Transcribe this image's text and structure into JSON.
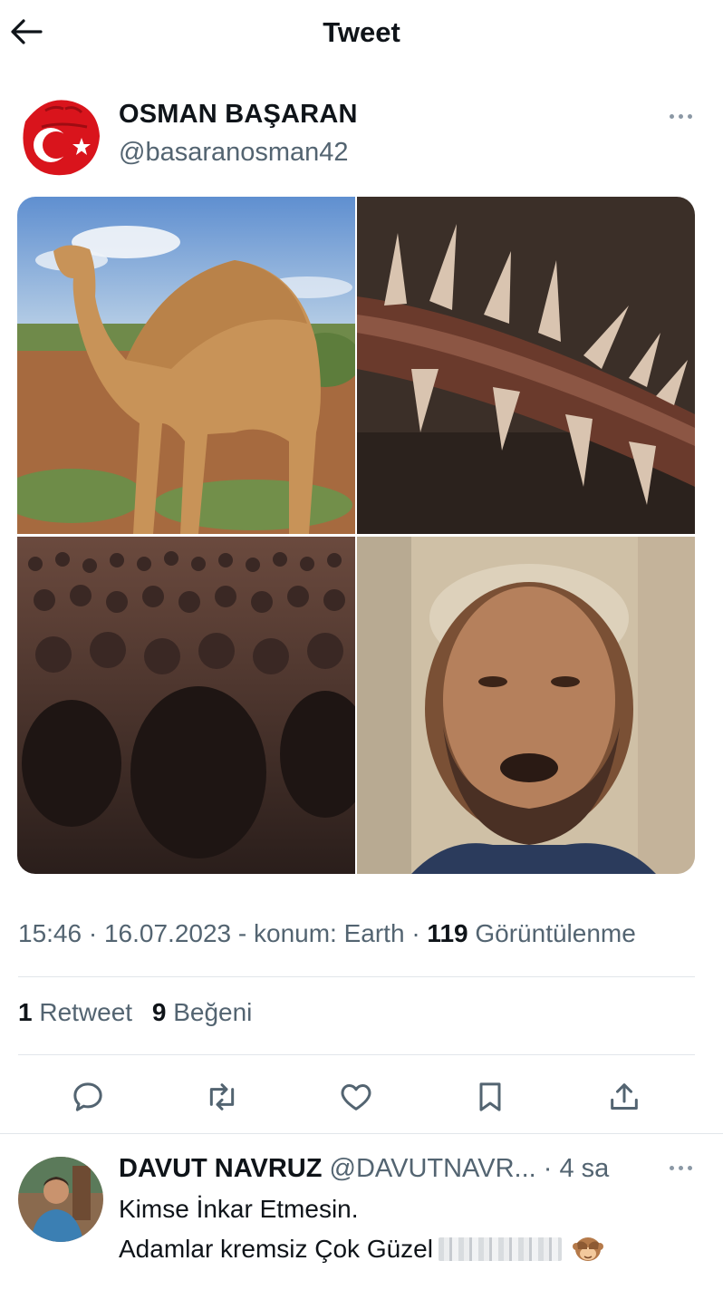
{
  "header": {
    "title": "Tweet"
  },
  "tweet": {
    "author_name": "OSMAN BAŞARAN",
    "author_handle": "@basaranosman42",
    "media": [
      "camel-photo",
      "thorns-photo",
      "crowd-photo",
      "man-photo"
    ],
    "time": "15:46",
    "date": "16.07.2023",
    "location": "konum: Earth",
    "views_count": "119",
    "views_label": "Görüntülenme",
    "retweets_count": "1",
    "retweets_label": "Retweet",
    "likes_count": "9",
    "likes_label": "Beğeni"
  },
  "actions": [
    {
      "icon": "reply-icon"
    },
    {
      "icon": "retweet-icon"
    },
    {
      "icon": "heart-icon"
    },
    {
      "icon": "bookmark-icon"
    },
    {
      "icon": "share-icon"
    }
  ],
  "reply": {
    "author_name": "DAVUT NAVRUZ",
    "author_handle": "@DAVUTNAVR...",
    "time": "· 4 sa",
    "line1": "Kimse İnkar Etmesin.",
    "line2": "Adamlar kremsiz  Çok Güzel"
  },
  "colors": {
    "text": "#0f1419",
    "muted": "#536471",
    "divider": "#e1e6ea"
  }
}
